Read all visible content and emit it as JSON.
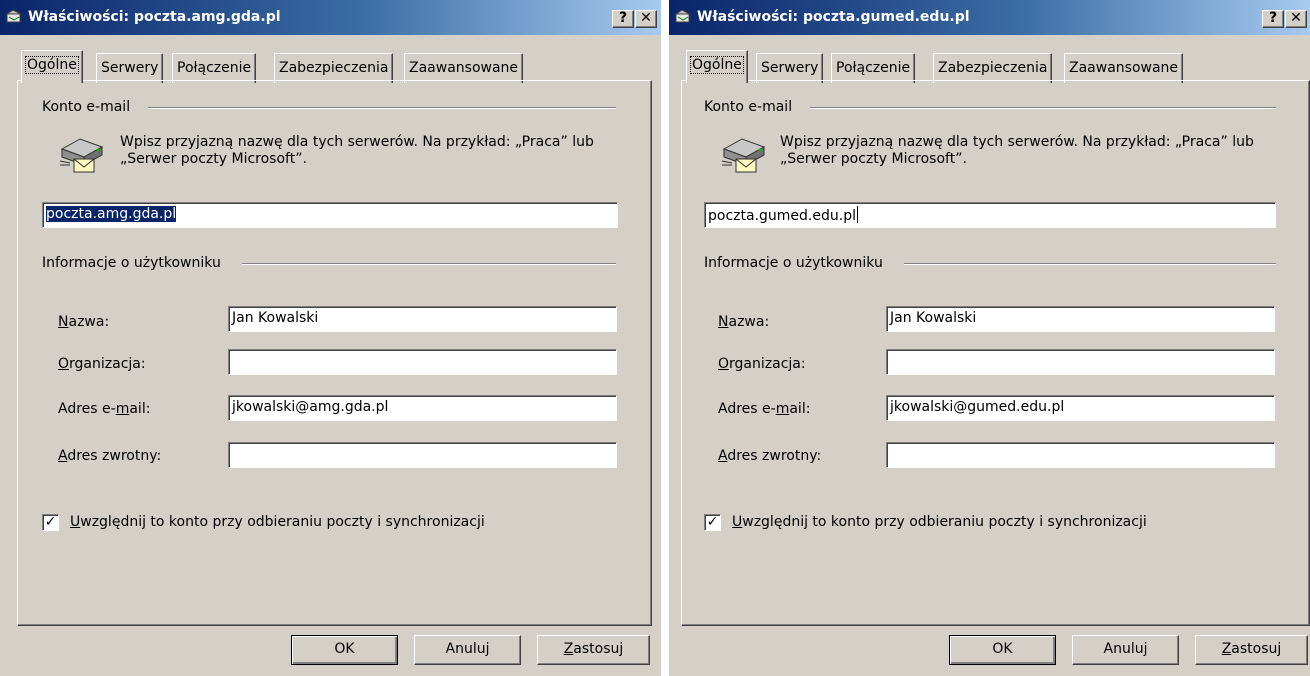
{
  "dialogs": [
    {
      "title": "Właściwości: poczta.amg.gda.pl",
      "help_btn": "?",
      "close_btn": "✕",
      "tabs": [
        "Ogólne",
        "Serwery",
        "Połączenie",
        "Zabezpieczenia",
        "Zaawansowane"
      ],
      "active_tab": "Ogólne",
      "account_group": "Konto e-mail",
      "desc_line1": "Wpisz przyjazną nazwę dla tych serwerów. Na przykład: „Praca” lub",
      "desc_line2": "„Serwer poczty Microsoft”.",
      "account_name": "poczta.amg.gda.pl",
      "user_group": "Informacje o użytkowniku",
      "name_label_u": "N",
      "name_label_rest": "azwa:",
      "name_value": "Jan Kowalski",
      "org_label_u": "O",
      "org_label_rest": "rganizacja:",
      "org_value": "",
      "email_label_pre": "Adres e-",
      "email_label_u": "m",
      "email_label_rest": "ail:",
      "email_value": "jkowalski@amg.gda.pl",
      "reply_label_u": "A",
      "reply_label_rest": "dres zwrotny:",
      "reply_value": "",
      "checkbox_u": "U",
      "checkbox_rest": "względnij to konto przy odbieraniu poczty i synchronizacji",
      "checkbox_mark": "✓",
      "ok": "OK",
      "cancel": "Anuluj",
      "apply_u": "Z",
      "apply_rest": "astosuj"
    },
    {
      "title": "Właściwości: poczta.gumed.edu.pl",
      "help_btn": "?",
      "close_btn": "✕",
      "tabs": [
        "Ogólne",
        "Serwery",
        "Połączenie",
        "Zabezpieczenia",
        "Zaawansowane"
      ],
      "active_tab": "Ogólne",
      "account_group": "Konto e-mail",
      "desc_line1": "Wpisz przyjazną nazwę dla tych serwerów. Na przykład: „Praca” lub",
      "desc_line2": "„Serwer poczty Microsoft”.",
      "account_name": "poczta.gumed.edu.pl",
      "user_group": "Informacje o użytkowniku",
      "name_label_u": "N",
      "name_label_rest": "azwa:",
      "name_value": "Jan Kowalski",
      "org_label_u": "O",
      "org_label_rest": "rganizacja:",
      "org_value": "",
      "email_label_pre": "Adres e-",
      "email_label_u": "m",
      "email_label_rest": "ail:",
      "email_value": "jkowalski@gumed.edu.pl",
      "reply_label_u": "A",
      "reply_label_rest": "dres zwrotny:",
      "reply_value": "",
      "checkbox_u": "U",
      "checkbox_rest": "względnij to konto przy odbieraniu poczty i synchronizacji",
      "checkbox_mark": "✓",
      "ok": "OK",
      "cancel": "Anuluj",
      "apply_u": "Z",
      "apply_rest": "astosuj"
    }
  ]
}
